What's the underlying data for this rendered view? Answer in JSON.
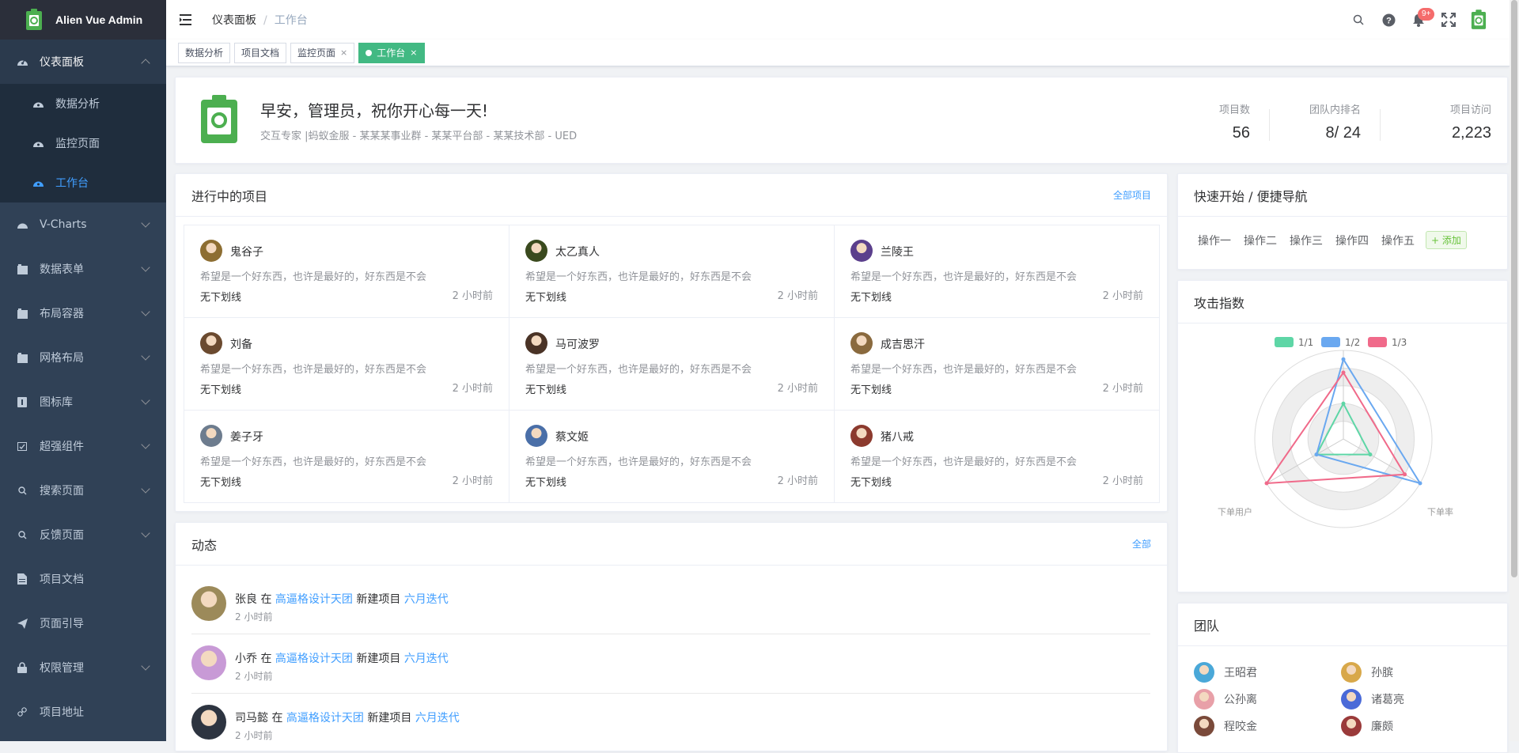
{
  "app": {
    "title": "Alien Vue Admin"
  },
  "sidebar": {
    "items": [
      {
        "label": "仪表面板",
        "icon": "dashboard-icon",
        "expanded": true,
        "children": [
          {
            "label": "数据分析",
            "icon": "dashboard-icon"
          },
          {
            "label": "监控页面",
            "icon": "dashboard-icon"
          },
          {
            "label": "工作台",
            "icon": "dashboard-icon",
            "active": true
          }
        ]
      },
      {
        "label": "V-Charts",
        "icon": "dashboard-icon"
      },
      {
        "label": "数据表单",
        "icon": "table-icon"
      },
      {
        "label": "布局容器",
        "icon": "table-icon"
      },
      {
        "label": "网格布局",
        "icon": "table-icon"
      },
      {
        "label": "图标库",
        "icon": "info-icon"
      },
      {
        "label": "超强组件",
        "icon": "component-icon"
      },
      {
        "label": "搜索页面",
        "icon": "search-icon"
      },
      {
        "label": "反馈页面",
        "icon": "search-icon"
      },
      {
        "label": "项目文档",
        "icon": "document-icon"
      },
      {
        "label": "页面引导",
        "icon": "send-icon"
      },
      {
        "label": "权限管理",
        "icon": "lock-icon"
      },
      {
        "label": "项目地址",
        "icon": "link-icon"
      }
    ]
  },
  "breadcrumb": {
    "first": "仪表面板",
    "sep": "/",
    "current": "工作台"
  },
  "navbar": {
    "notification_badge": "9+"
  },
  "tags": [
    {
      "label": "数据分析",
      "closable": false
    },
    {
      "label": "项目文档",
      "closable": false
    },
    {
      "label": "监控页面",
      "closable": true
    },
    {
      "label": "工作台",
      "closable": true,
      "active": true
    }
  ],
  "tag_close": "×",
  "welcome": {
    "greeting": "早安，管理员，祝你开心每一天!",
    "desc": "交互专家 |蚂蚁金服 - 某某某事业群 - 某某平台部 - 某某技术部 - UED",
    "stats": [
      {
        "label": "项目数",
        "value": "56"
      },
      {
        "label": "团队内排名",
        "value": "8/ 24"
      },
      {
        "label": "项目访问",
        "value": "2,223"
      }
    ]
  },
  "projects": {
    "title": "进行中的项目",
    "more": "全部项目",
    "items": [
      {
        "name": "鬼谷子",
        "desc": "希望是一个好东西，也许是最好的，好东西是不会",
        "team": "无下划线",
        "time": "2 小时前",
        "color": "#8d6e32"
      },
      {
        "name": "太乙真人",
        "desc": "希望是一个好东西，也许是最好的，好东西是不会",
        "team": "无下划线",
        "time": "2 小时前",
        "color": "#3a4a1e"
      },
      {
        "name": "兰陵王",
        "desc": "希望是一个好东西，也许是最好的，好东西是不会",
        "team": "无下划线",
        "time": "2 小时前",
        "color": "#5b3f8c"
      },
      {
        "name": "刘备",
        "desc": "希望是一个好东西，也许是最好的，好东西是不会",
        "team": "无下划线",
        "time": "2 小时前",
        "color": "#6b4a2f"
      },
      {
        "name": "马可波罗",
        "desc": "希望是一个好东西，也许是最好的，好东西是不会",
        "team": "无下划线",
        "time": "2 小时前",
        "color": "#4a3326"
      },
      {
        "name": "成吉思汗",
        "desc": "希望是一个好东西，也许是最好的，好东西是不会",
        "team": "无下划线",
        "time": "2 小时前",
        "color": "#8a6a3e"
      },
      {
        "name": "姜子牙",
        "desc": "希望是一个好东西，也许是最好的，好东西是不会",
        "team": "无下划线",
        "time": "2 小时前",
        "color": "#6d7c8e"
      },
      {
        "name": "蔡文姬",
        "desc": "希望是一个好东西，也许是最好的，好东西是不会",
        "team": "无下划线",
        "time": "2 小时前",
        "color": "#4a6fa8"
      },
      {
        "name": "猪八戒",
        "desc": "希望是一个好东西，也许是最好的，好东西是不会",
        "team": "无下划线",
        "time": "2 小时前",
        "color": "#8c3a2e"
      }
    ]
  },
  "activity": {
    "title": "动态",
    "more": "全部",
    "items": [
      {
        "user": "张良",
        "action_in": "在",
        "group": "高逼格设计天团",
        "action": "新建项目",
        "project": "六月迭代",
        "time": "2 小时前",
        "color": "#9c8a5a"
      },
      {
        "user": "小乔",
        "action_in": "在",
        "group": "高逼格设计天团",
        "action": "新建项目",
        "project": "六月迭代",
        "time": "2 小时前",
        "color": "#c89ad6"
      },
      {
        "user": "司马懿",
        "action_in": "在",
        "group": "高逼格设计天团",
        "action": "新建项目",
        "project": "六月迭代",
        "time": "2 小时前",
        "color": "#2d3440"
      }
    ]
  },
  "quick_nav": {
    "title": "快速开始 / 便捷导航",
    "links": [
      "操作一",
      "操作二",
      "操作三",
      "操作四",
      "操作五"
    ],
    "add_label": "+ 添加"
  },
  "radar": {
    "title": "攻击指数",
    "legend": [
      "1/1",
      "1/2",
      "1/3"
    ],
    "axis_labels": [
      "下单用户",
      "下单率"
    ]
  },
  "chart_data": {
    "type": "radar",
    "axes": [
      "",
      "下单用户",
      "下单率"
    ],
    "series": [
      {
        "name": "1/1",
        "values": [
          0.4,
          0.35,
          0.35
        ],
        "color": "#5ed6a6"
      },
      {
        "name": "1/2",
        "values": [
          0.9,
          1.0,
          0.35
        ],
        "color": "#6aa8f0"
      },
      {
        "name": "1/3",
        "values": [
          0.75,
          0.8,
          1.0
        ],
        "color": "#f06a8a"
      }
    ],
    "legend_position": "top-center"
  },
  "team": {
    "title": "团队",
    "members": [
      {
        "name": "王昭君",
        "color": "#4aa8d8"
      },
      {
        "name": "孙膑",
        "color": "#d8a84a"
      },
      {
        "name": "公孙离",
        "color": "#e8a0a8"
      },
      {
        "name": "诸葛亮",
        "color": "#4a6ad8"
      },
      {
        "name": "程咬金",
        "color": "#7a4a3a"
      },
      {
        "name": "廉颇",
        "color": "#9a3a3a"
      }
    ]
  }
}
